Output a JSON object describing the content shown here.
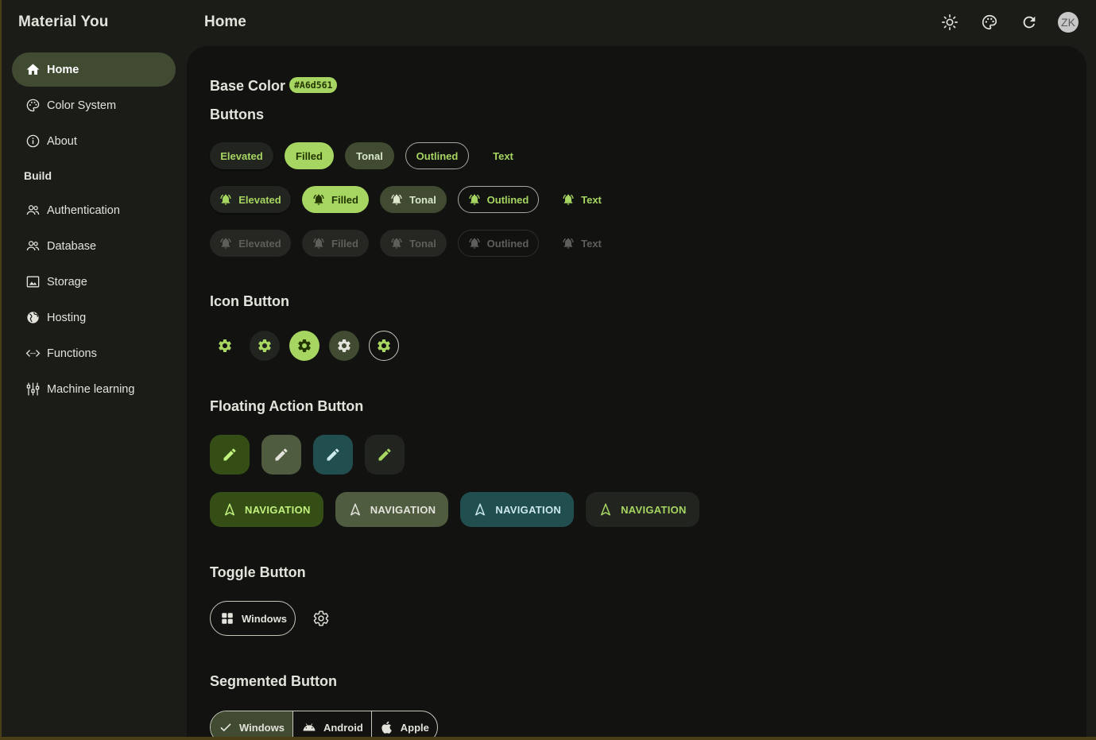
{
  "app": {
    "title": "Material You"
  },
  "header": {
    "title": "Home",
    "actions": [
      {
        "name": "brightness-icon"
      },
      {
        "name": "palette-icon"
      },
      {
        "name": "refresh-icon"
      }
    ],
    "avatar_initials": "ZK"
  },
  "sidebar": {
    "items": [
      {
        "label": "Home",
        "icon": "home-icon",
        "active": true
      },
      {
        "label": "Color System",
        "icon": "palette-icon",
        "active": false
      },
      {
        "label": "About",
        "icon": "info-icon",
        "active": false
      }
    ],
    "section_label": "Build",
    "build_items": [
      {
        "label": "Authentication",
        "icon": "people-icon"
      },
      {
        "label": "Database",
        "icon": "people-icon"
      },
      {
        "label": "Storage",
        "icon": "image-icon"
      },
      {
        "label": "Hosting",
        "icon": "globe-icon"
      },
      {
        "label": "Functions",
        "icon": "code-icon"
      },
      {
        "label": "Machine learning",
        "icon": "tune-icon"
      }
    ]
  },
  "main": {
    "base_color_title": "Base Color",
    "base_color_value": "#A6d561",
    "buttons_title": "Buttons",
    "button_labels": {
      "elevated": "Elevated",
      "filled": "Filled",
      "tonal": "Tonal",
      "outlined": "Outlined",
      "text": "Text"
    },
    "icon_button_title": "Icon Button",
    "fab_title": "Floating Action Button",
    "extended_fab_label": "NAVIGATION",
    "toggle_button_title": "Toggle Button",
    "toggle_button_label": "Windows",
    "segmented_button_title": "Segmented Button",
    "segments": [
      {
        "label": "Windows",
        "icon": "check-icon",
        "selected": true
      },
      {
        "label": "Android",
        "icon": "android-icon",
        "selected": false
      },
      {
        "label": "Apple",
        "icon": "apple-icon",
        "selected": false
      }
    ]
  },
  "colors": {
    "primary": "#a6d561",
    "on_primary": "#233600",
    "secondary_container": "#404b32",
    "tertiary_container": "#214e4e",
    "background": "#1b1c18",
    "surface": "#121310"
  }
}
